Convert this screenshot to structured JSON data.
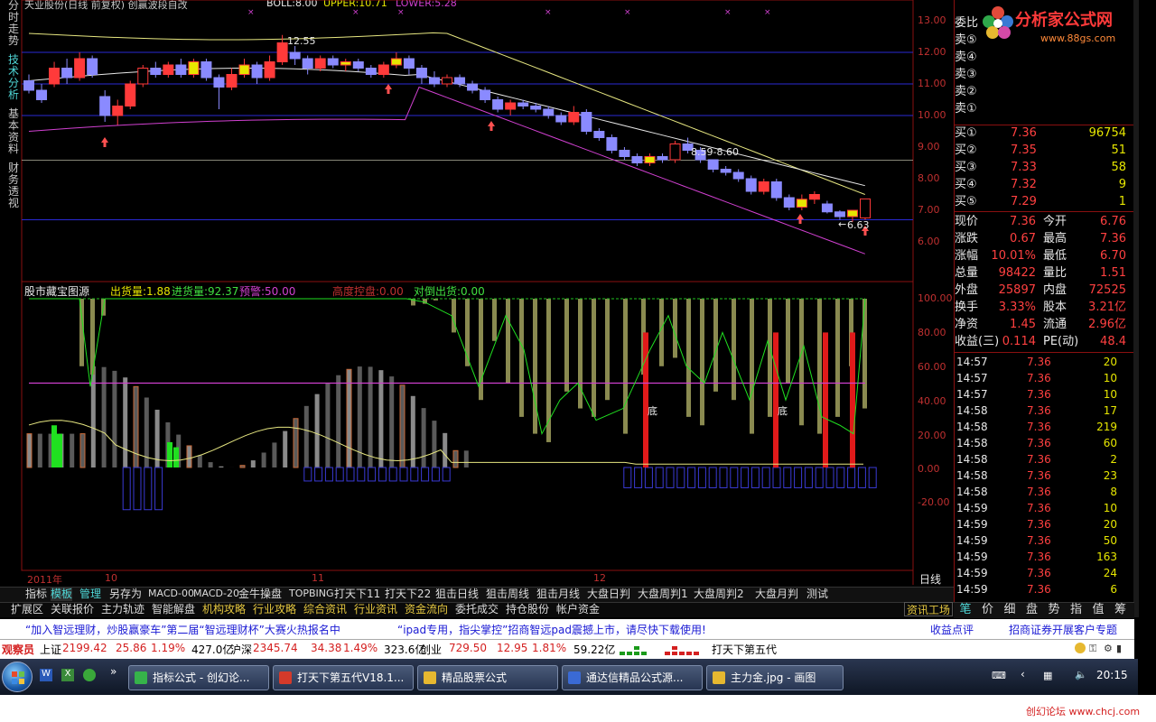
{
  "top_header": {
    "stock_title": "天业股份(日线 前复权) 创赢波段自改",
    "boll": "BOLL:8.00",
    "upper": "UPPER:10.71",
    "lower": "LOWER:5.28"
  },
  "left_tabs": [
    "分时走势",
    "技术分析",
    "基本资料",
    "财务透视"
  ],
  "price_axis": [
    "13.00",
    "12.00",
    "11.00",
    "10.00",
    "9.00",
    "8.00",
    "7.00",
    "6.00"
  ],
  "annotations": {
    "high": "12.55",
    "mid": "8.59-8.60",
    "low": "6.63"
  },
  "lower_header": {
    "name": "股市藏宝图源",
    "out": "出货量:1.88",
    "in": "进货量:92.37",
    "warn": "预警:50.00",
    "high_ctrl": "高度控盘:0.00",
    "hedge": "对倒出货:0.00"
  },
  "lower_axis": [
    "100.00",
    "80.00",
    "60.00",
    "40.00",
    "20.00",
    "0.00",
    "-20.00"
  ],
  "marks": [
    "底",
    "底"
  ],
  "time_axis": {
    "year": "2011年",
    "m10": "10",
    "m11": "11",
    "m12": "12",
    "period": "日线"
  },
  "toolbar": [
    "指标",
    "模板",
    "管理",
    "另存为",
    "MACD-00",
    "MACD-20",
    "金牛操盘",
    "TOPBING",
    "打天下11",
    "打天下22",
    "狙击日线",
    "狙击周线",
    "狙击月线",
    "大盘日判",
    "大盘周判1",
    "大盘周判2",
    "大盘月判",
    "测试"
  ],
  "toolbar2": [
    "扩展区",
    "关联报价",
    "主力轨迹",
    "智能解盘",
    "机构攻略",
    "行业攻略",
    "综合资讯",
    "行业资讯",
    "资金流向",
    "委托成交",
    "持仓股份",
    "帐户资金"
  ],
  "toolbar2_right": "资讯工场",
  "right_tabs": [
    "笔",
    "价",
    "细",
    "盘",
    "势",
    "指",
    "值",
    "筹"
  ],
  "logo": {
    "text": "分析家公式网",
    "url": "www.88gs.com"
  },
  "sell_rows": [
    {
      "label": "委比",
      "price": "",
      "vol": ""
    },
    {
      "label": "卖⑤",
      "price": "",
      "vol": ""
    },
    {
      "label": "卖④",
      "price": "",
      "vol": ""
    },
    {
      "label": "卖③",
      "price": "",
      "vol": ""
    },
    {
      "label": "卖②",
      "price": "",
      "vol": ""
    },
    {
      "label": "卖①",
      "price": "",
      "vol": ""
    }
  ],
  "buy_rows": [
    {
      "label": "买①",
      "price": "7.36",
      "vol": "96754"
    },
    {
      "label": "买②",
      "price": "7.35",
      "vol": "51"
    },
    {
      "label": "买③",
      "price": "7.33",
      "vol": "58"
    },
    {
      "label": "买④",
      "price": "7.32",
      "vol": "9"
    },
    {
      "label": "买⑤",
      "price": "7.29",
      "vol": "1"
    }
  ],
  "quote_rows": [
    {
      "l1": "现价",
      "v1": "7.36",
      "l2": "今开",
      "v2": "6.76"
    },
    {
      "l1": "涨跌",
      "v1": "0.67",
      "l2": "最高",
      "v2": "7.36"
    },
    {
      "l1": "涨幅",
      "v1": "10.01%",
      "l2": "最低",
      "v2": "6.70"
    },
    {
      "l1": "总量",
      "v1": "98422",
      "l2": "量比",
      "v2": "1.51"
    },
    {
      "l1": "外盘",
      "v1": "25897",
      "l2": "内盘",
      "v2": "72525"
    },
    {
      "l1": "换手",
      "v1": "3.33%",
      "l2": "股本",
      "v2": "3.21亿"
    },
    {
      "l1": "净资",
      "v1": "1.45",
      "l2": "流通",
      "v2": "2.96亿"
    },
    {
      "l1": "收益(三)",
      "v1": "0.114",
      "l2": "PE(动)",
      "v2": "48.4"
    }
  ],
  "ticks": [
    {
      "t": "14:57",
      "p": "7.36",
      "v": "20"
    },
    {
      "t": "14:57",
      "p": "7.36",
      "v": "10"
    },
    {
      "t": "14:57",
      "p": "7.36",
      "v": "10"
    },
    {
      "t": "14:58",
      "p": "7.36",
      "v": "17"
    },
    {
      "t": "14:58",
      "p": "7.36",
      "v": "219"
    },
    {
      "t": "14:58",
      "p": "7.36",
      "v": "60"
    },
    {
      "t": "14:58",
      "p": "7.36",
      "v": "2"
    },
    {
      "t": "14:58",
      "p": "7.36",
      "v": "23"
    },
    {
      "t": "14:58",
      "p": "7.36",
      "v": "8"
    },
    {
      "t": "14:59",
      "p": "7.36",
      "v": "10"
    },
    {
      "t": "14:59",
      "p": "7.36",
      "v": "20"
    },
    {
      "t": "14:59",
      "p": "7.36",
      "v": "50"
    },
    {
      "t": "14:59",
      "p": "7.36",
      "v": "163"
    },
    {
      "t": "14:59",
      "p": "7.36",
      "v": "24"
    },
    {
      "t": "14:59",
      "p": "7.36",
      "v": "6"
    }
  ],
  "news": {
    "n1": "“加入智远理财，炒股赢豪车”第二届“智远理财杯”大赛火热报名中",
    "n2": "“ipad专用，指尖掌控”招商智远pad震撼上市，请尽快下载使用!",
    "n3": "收益点评",
    "n4": "招商证券开展客户专题"
  },
  "index_bar": {
    "observer": "观察员",
    "sh": "上证",
    "sh_v": "2199.42",
    "sh_c": "25.86",
    "sh_p": "1.19%",
    "sh_a": "427.0亿",
    "sz": "沪深",
    "sz_v": "2345.74",
    "sz_c": "34.38",
    "sz_p": "1.49%",
    "sz_a": "323.6亿",
    "cy": "创业",
    "cy_v": "729.50",
    "cy_c": "12.95",
    "cy_p": "1.81%",
    "cy_a": "59.22亿",
    "formula": "打天下第五代"
  },
  "taskbar": [
    {
      "label": "指标公式 - 创幻论...",
      "color": "#36b34a"
    },
    {
      "label": "打天下第五代V18.1...",
      "color": "#d43a2a"
    },
    {
      "label": "精品股票公式",
      "color": "#e6b830"
    },
    {
      "label": "通达信精品公式源...",
      "color": "#3a6ad4"
    },
    {
      "label": "主力金.jpg - 画图",
      "color": "#e6b830"
    }
  ],
  "clock": "20:15",
  "watermark": "创幻论坛 www.chcj.com"
}
